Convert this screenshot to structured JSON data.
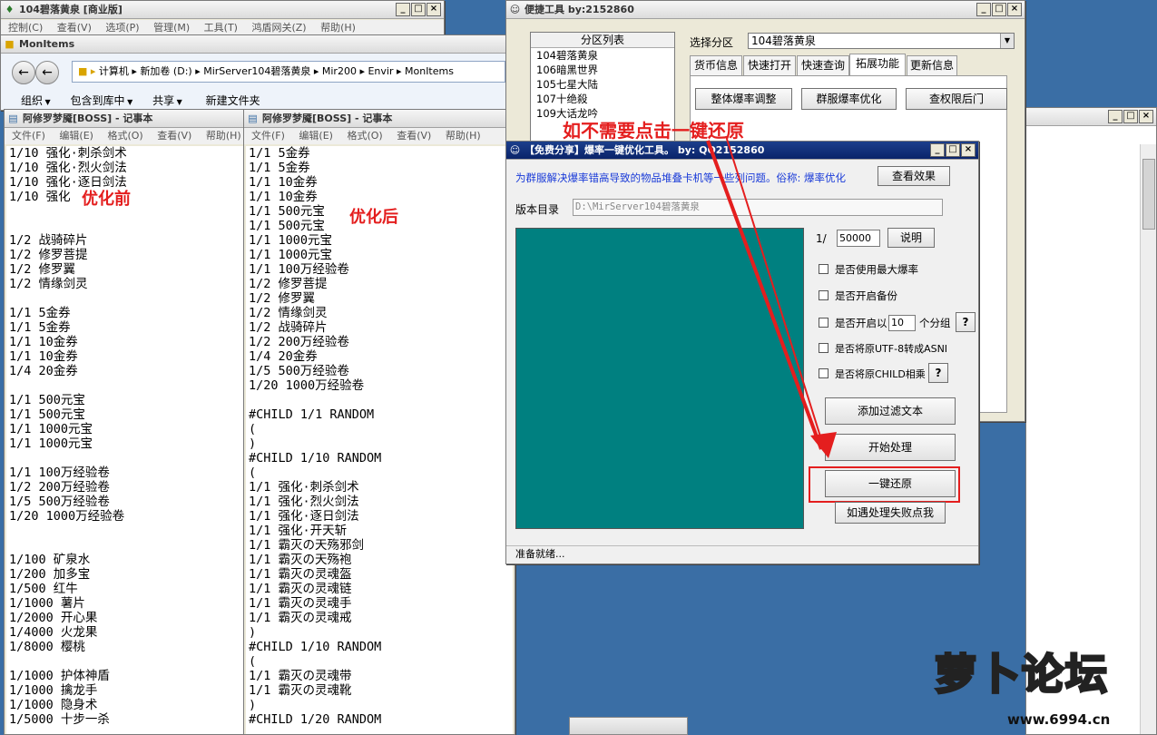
{
  "desktop": {
    "launcher_title": "104碧落黄泉 [商业版]",
    "launcher_menu": [
      "控制(C)",
      "查看(V)",
      "选项(P)",
      "管理(M)",
      "工具(T)",
      "鸿盾网关(Z)",
      "帮助(H)"
    ]
  },
  "explorer": {
    "title": "MonItems",
    "path": [
      "计算机",
      "新加卷 (D:)",
      "MirServer104碧落黄泉",
      "Mir200",
      "Envir",
      "MonItems"
    ],
    "toolbar": [
      "组织",
      "包含到库中",
      "共享",
      "新建文件夹"
    ]
  },
  "notepad_before": {
    "title": "阿修罗梦魇[BOSS] - 记事本",
    "menu": [
      "文件(F)",
      "编辑(E)",
      "格式(O)",
      "查看(V)",
      "帮助(H)"
    ],
    "overlay_label": "优化前",
    "lines": [
      "1/10 强化·刺杀剑术",
      "1/10 强化·烈火剑法",
      "1/10 强化·逐日剑法",
      "1/10 强化",
      "",
      "",
      "1/2 战骑碎片",
      "1/2 修罗菩提",
      "1/2 修罗翼",
      "1/2 情缘剑灵",
      "",
      "1/1 5金券",
      "1/1 5金券",
      "1/1 10金券",
      "1/1 10金券",
      "1/4 20金券",
      "",
      "1/1 500元宝",
      "1/1 500元宝",
      "1/1 1000元宝",
      "1/1 1000元宝",
      "",
      "1/1 100万经验卷",
      "1/2 200万经验卷",
      "1/5 500万经验卷",
      "1/20 1000万经验卷",
      "",
      "",
      "1/100 矿泉水",
      "1/200 加多宝",
      "1/500 红牛",
      "1/1000 薯片",
      "1/2000 开心果",
      "1/4000 火龙果",
      "1/8000 樱桃",
      "",
      "1/1000 护体神盾",
      "1/1000 擒龙手",
      "1/1000 隐身术",
      "1/5000 十步一杀"
    ]
  },
  "notepad_after": {
    "title": "阿修罗梦魇[BOSS] - 记事本",
    "menu": [
      "文件(F)",
      "编辑(E)",
      "格式(O)",
      "查看(V)",
      "帮助(H)"
    ],
    "overlay_label": "优化后",
    "lines": [
      "1/1 5金券",
      "1/1 5金券",
      "1/1 10金券",
      "1/1 10金券",
      "1/1 500元宝",
      "1/1 500元宝",
      "1/1 1000元宝",
      "1/1 1000元宝",
      "1/1 100万经验卷",
      "1/2 修罗菩提",
      "1/2 修罗翼",
      "1/2 情缘剑灵",
      "1/2 战骑碎片",
      "1/2 200万经验卷",
      "1/4 20金券",
      "1/5 500万经验卷",
      "1/20 1000万经验卷",
      "",
      "#CHILD 1/1 RANDOM",
      "(",
      ")",
      "#CHILD 1/10 RANDOM",
      "(",
      "1/1 强化·刺杀剑术",
      "1/1 强化·烈火剑法",
      "1/1 强化·逐日剑法",
      "1/1 强化·开天斩",
      "1/1 霸灭の天殇邪剑",
      "1/1 霸灭の天殇袍",
      "1/1 霸灭の灵魂盔",
      "1/1 霸灭の灵魂链",
      "1/1 霸灭の灵魂手",
      "1/1 霸灭の灵魂戒",
      ")",
      "#CHILD 1/10 RANDOM",
      "(",
      "1/1 霸灭の灵魂带",
      "1/1 霸灭の灵魂靴",
      ")",
      "#CHILD 1/20 RANDOM"
    ]
  },
  "quick_tool": {
    "title": "便捷工具  by:2152860",
    "partition_header": "分区列表",
    "partitions": [
      "104碧落黄泉",
      "106暗黑世界",
      "105七星大陆",
      "107十绝殺",
      "109大话龙吟"
    ],
    "select_label": "选择分区",
    "select_value": "104碧落黄泉",
    "tabs": [
      "货币信息",
      "快速打开",
      "快速查询",
      "拓展功能",
      "更新信息"
    ],
    "buttons": [
      "整体爆率调整",
      "群服爆率优化",
      "查权限后门"
    ]
  },
  "optimizer": {
    "title": "【免费分享】爆率一键优化工具。  by: QQ2152860",
    "description": "为群服解决爆率错高导致的物品堆叠卡机等一些列问题。俗称: 爆率优化",
    "view_effect": "查看效果",
    "dir_label": "版本目录",
    "dir_value": "D:\\MirServer104碧落黄泉",
    "ratio_prefix": "1/",
    "ratio_value": "50000",
    "explain_button": "说明",
    "options": [
      "是否使用最大爆率",
      "是否开启备份",
      "是否开启以",
      "是否将原UTF-8转成ASNI",
      "是否将原CHILD相乘"
    ],
    "group_value": "10",
    "group_suffix": "个分组",
    "help": "?",
    "add_filter": "添加过滤文本",
    "start": "开始处理",
    "restore": "一键还原",
    "fail_click": "如遇处理失败点我",
    "status": "准备就绪..."
  },
  "annotation": {
    "text": "如不需要点击一键还原",
    "color": "#e41e1e"
  },
  "watermark": {
    "logo": "萝卜论坛",
    "url": "www.6994.cn"
  }
}
